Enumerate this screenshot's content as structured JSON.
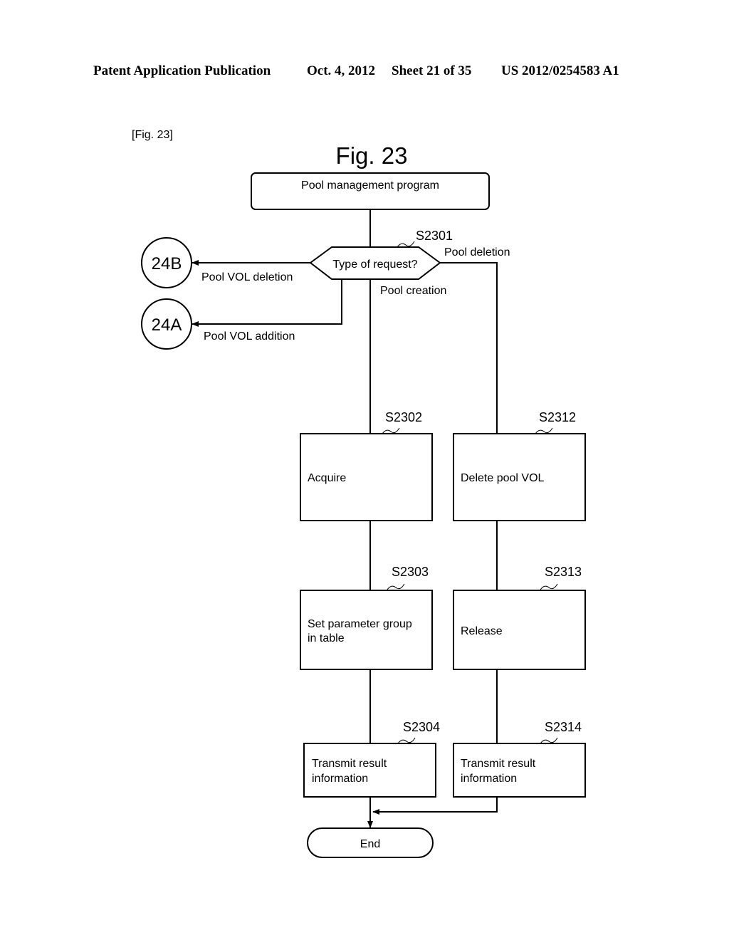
{
  "header": {
    "publication": "Patent Application Publication",
    "date": "Oct. 4, 2012",
    "sheet": "Sheet 21 of 35",
    "number": "US 2012/0254583 A1"
  },
  "figure": {
    "tag": "[Fig. 23]",
    "title": "Fig. 23"
  },
  "flowchart": {
    "start": "Pool management program",
    "decision": {
      "label": "Type of request?",
      "step": "S2301"
    },
    "branches": {
      "pool_deletion": "Pool deletion",
      "pool_creation": "Pool creation",
      "pool_vol_deletion": "Pool VOL deletion",
      "pool_vol_addition": "Pool VOL addition"
    },
    "connectors": {
      "b": "24B",
      "a": "24A"
    },
    "left": [
      {
        "step": "S2302",
        "lines": [
          "Acquire"
        ]
      },
      {
        "step": "S2303",
        "lines": [
          "Set parameter group",
          "in table"
        ]
      },
      {
        "step": "S2304",
        "lines": [
          "Transmit result",
          "information"
        ]
      }
    ],
    "right": [
      {
        "step": "S2312",
        "lines": [
          "Delete pool VOL"
        ]
      },
      {
        "step": "S2313",
        "lines": [
          "Release"
        ]
      },
      {
        "step": "S2314",
        "lines": [
          "Transmit result",
          "information"
        ]
      }
    ],
    "end": "End"
  }
}
